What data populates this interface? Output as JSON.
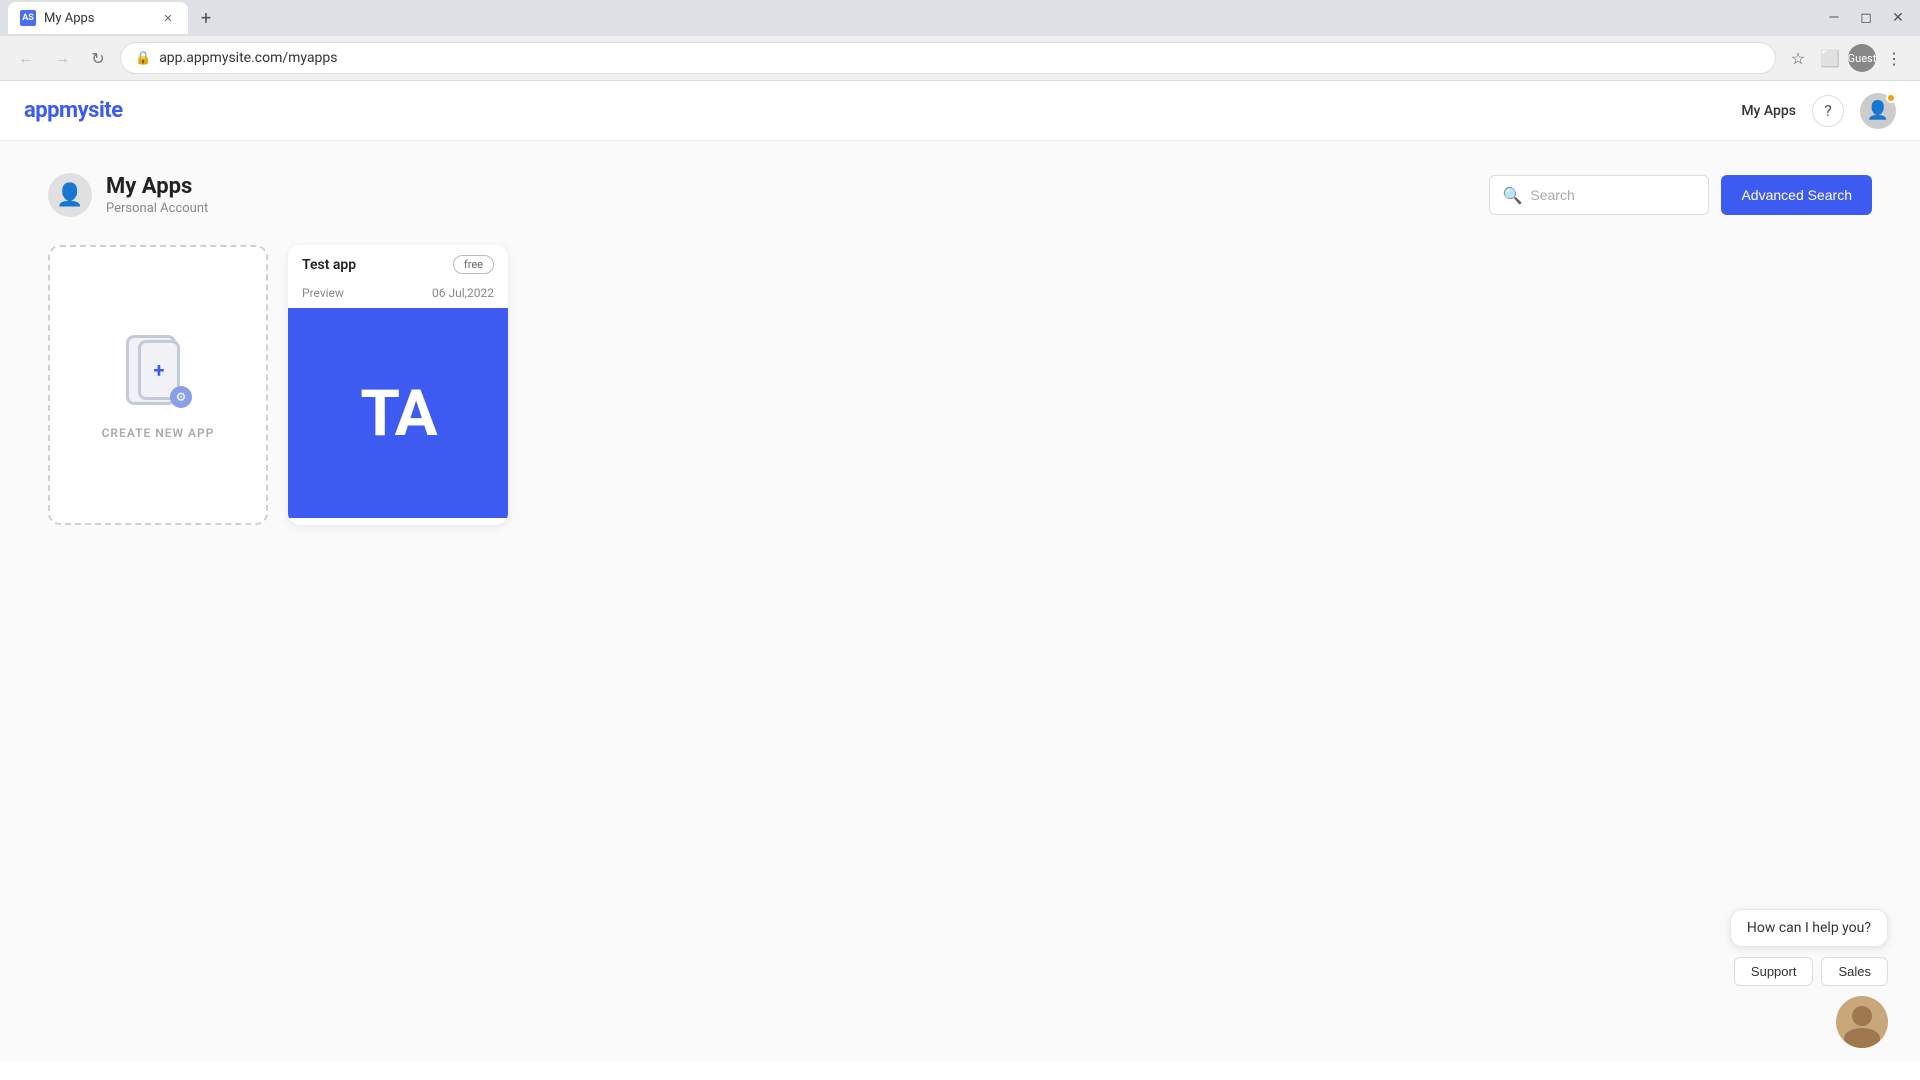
{
  "browser": {
    "tab_title": "My Apps",
    "tab_favicon": "AS",
    "url": "app.appmysite.com/myapps",
    "profile_label": "Guest"
  },
  "header": {
    "logo": "appmysite",
    "my_apps_link": "My Apps"
  },
  "page": {
    "title": "My Apps",
    "subtitle": "Personal Account"
  },
  "search": {
    "placeholder": "Search",
    "advanced_button": "Advanced Search"
  },
  "create_card": {
    "label": "CREATE NEW APP"
  },
  "apps": [
    {
      "name": "Test app",
      "badge": "free",
      "status": "Preview",
      "date": "06 Jul,2022",
      "initials": "TA",
      "color": "#3d5af1"
    }
  ],
  "chat": {
    "bubble_text": "How can I help you?",
    "support_button": "Support",
    "sales_button": "Sales"
  }
}
